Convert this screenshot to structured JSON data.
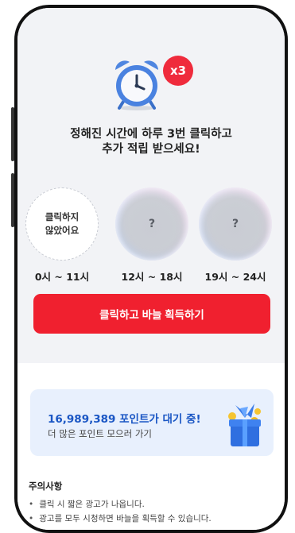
{
  "promo": {
    "multiplier_badge": "x3",
    "headline_line1": "정해진 시간에 하루 3번 클릭하고",
    "headline_line2": "추가 적립 받으세요!"
  },
  "slots": [
    {
      "status_text_line1": "클릭하지",
      "status_text_line2": "않았어요",
      "time_range": "0시 ~ 11시"
    },
    {
      "status_text": "?",
      "time_range": "12시 ~ 18시"
    },
    {
      "status_text": "?",
      "time_range": "19시 ~ 24시"
    }
  ],
  "cta": {
    "label": "클릭하고 바늘 획득하기"
  },
  "points_card": {
    "title": "16,989,389 포인트가 대기 중!",
    "subtitle": "더 많은 포인트 모으러 가기"
  },
  "notice": {
    "title": "주의사항",
    "items": [
      "클릭 시 짧은 광고가 나옵니다.",
      "광고를 모두 시청하면 바늘을 획득할 수 있습니다."
    ]
  },
  "colors": {
    "accent_red": "#f0202f",
    "points_blue": "#1a56c4",
    "card_bg": "#e8f0fd"
  },
  "icons": [
    "alarm-clock-icon",
    "gift-box-icon"
  ]
}
